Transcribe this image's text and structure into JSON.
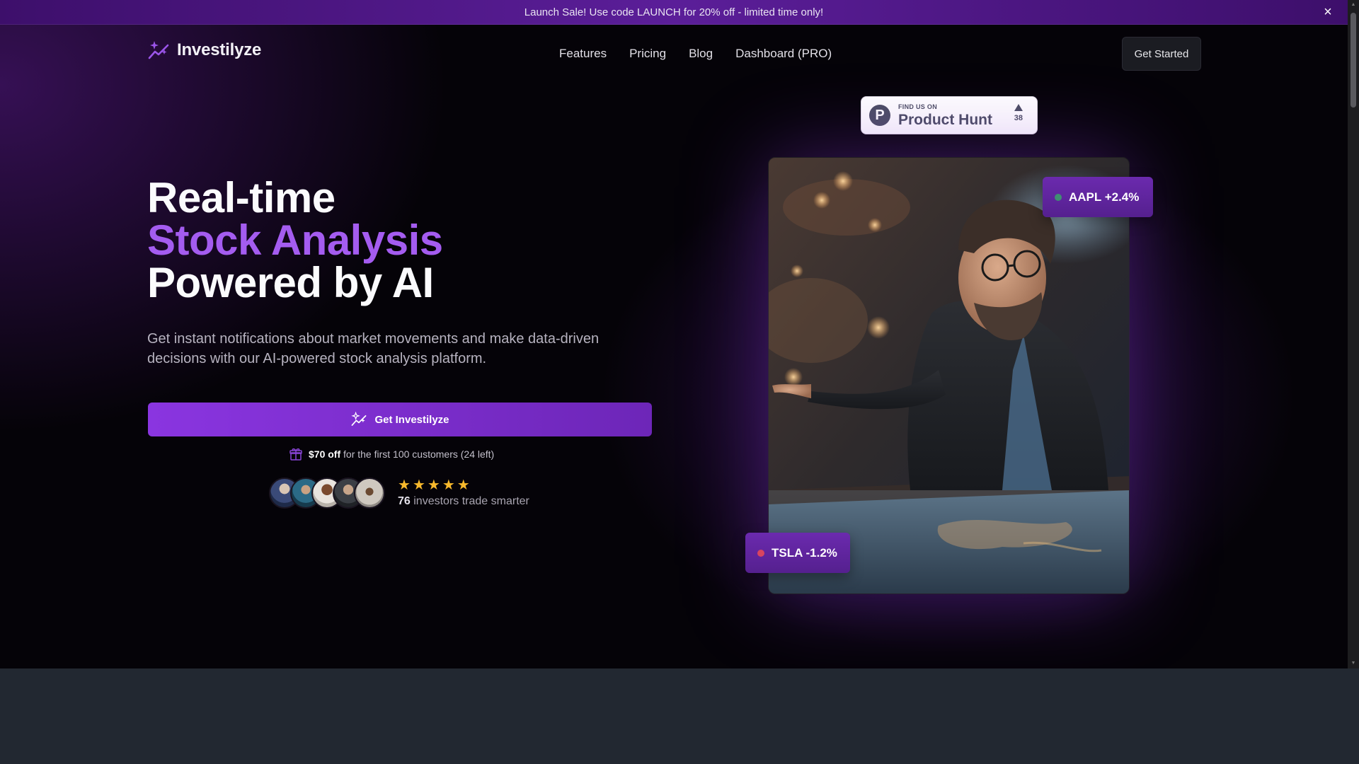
{
  "announcement": {
    "text": "Launch Sale! Use code LAUNCH for 20% off - limited time only!",
    "close_icon": "×"
  },
  "nav": {
    "brand": "Investilyze",
    "links": [
      "Features",
      "Pricing",
      "Blog",
      "Dashboard (PRO)"
    ],
    "cta": "Get Started"
  },
  "product_hunt": {
    "small": "FIND US ON",
    "big": "Product Hunt",
    "logo_letter": "P",
    "votes": "38"
  },
  "hero": {
    "line1": "Real-time",
    "line2": "Stock Analysis",
    "line3": "Powered by AI",
    "subtitle": "Get instant notifications about market movements and make data-driven decisions with our AI-powered stock analysis platform.",
    "cta": "Get Investilyze",
    "offer_bold": "$70 off",
    "offer_rest": "for the first 100 customers (24 left)",
    "rating_stars": 5,
    "investor_count": "76",
    "investor_text": "investors trade smarter"
  },
  "tickers": {
    "aapl": "AAPL +2.4%",
    "tsla": "TSLA -1.2%"
  },
  "colors": {
    "accent": "#a45cf0",
    "button": "#8a35e0",
    "star": "#f7b92c",
    "up_dot": "#3f8f72",
    "down_dot": "#d8455f"
  }
}
